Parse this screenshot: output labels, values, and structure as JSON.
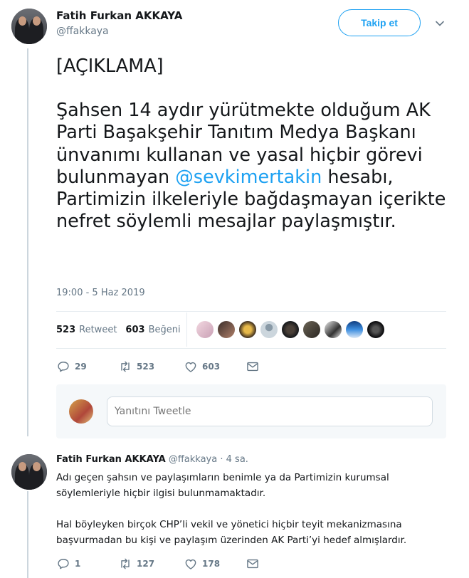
{
  "tweet": {
    "author_name": "Fatih Furkan AKKAYA",
    "author_handle": "@ffakkaya",
    "follow_label": "Takip et",
    "heading": "[AÇIKLAMA]",
    "body_before": "Şahsen 14 aydır yürütmekte olduğum AK Parti Başakşehir Tanıtım Medya Başkanı ünvanımı kullanan ve yasal hiçbir görevi bulunmayan ",
    "mention": "@sevkimertakin",
    "body_after": " hesabı, Partimizin ilkeleriyle bağdaşmayan içerikte nefret söylemli mesajlar paylaşmıştır.",
    "timestamp": "19:00 - 5 Haz 2019",
    "stats": {
      "retweet_count": "523",
      "retweet_label": "Retweet",
      "like_count": "603",
      "like_label": "Beğeni"
    },
    "actions": {
      "reply_count": "29",
      "retweet_count": "523",
      "like_count": "603"
    }
  },
  "reply_box": {
    "placeholder": "Yanıtını Tweetle"
  },
  "reply_tweet": {
    "author_name": "Fatih Furkan AKKAYA",
    "author_handle": "@ffakkaya",
    "time_ago": "· 4 sa.",
    "paragraph1": "Adı geçen şahsın ve paylaşımların benimle ya da Partimizin kurumsal söylemleriyle hiçbir ilgisi bulunmamaktadır.",
    "paragraph2": "Hal böyleyken birçok CHP’li vekil ve yönetici hiçbir teyit mekanizmasına başvurmadan bu kişi ve paylaşım üzerinden AK Parti’yi hedef almışlardır.",
    "actions": {
      "reply_count": "1",
      "retweet_count": "127",
      "like_count": "178"
    }
  },
  "colors": {
    "accent": "#1da1f2",
    "muted": "#657786",
    "divider": "#e6ecf0"
  },
  "icons": [
    "reply-icon",
    "retweet-icon",
    "like-icon",
    "message-icon",
    "chevron-down-icon"
  ]
}
